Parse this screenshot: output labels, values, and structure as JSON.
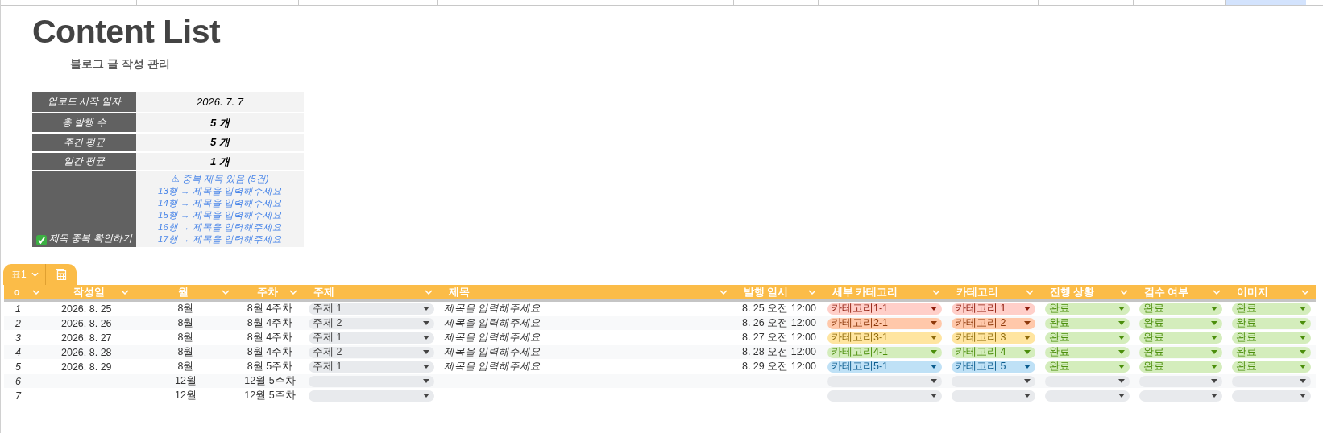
{
  "title": "Content List",
  "subtitle": "블로그 글 작성 관리",
  "summary": [
    {
      "label": "업로드 시작 일자",
      "value": "2026. 7. 7",
      "bold": false
    },
    {
      "label": "총 발행 수",
      "value": "5 개",
      "bold": true
    },
    {
      "label": "주간 평균",
      "value": "5 개",
      "bold": true
    },
    {
      "label": "일간 평균",
      "value": "1 개",
      "bold": true
    }
  ],
  "duplicate_check": {
    "label": "제목 중복 확인하기",
    "lines": [
      "⚠ 중복 제목 있음 (5건)",
      "13행 → 제목을 입력해주세요",
      "14행 → 제목을 입력해주세요",
      "15행 → 제목을 입력해주세요",
      "16행 → 제목을 입력해주세요",
      "17행 → 제목을 입력해주세요"
    ]
  },
  "table_tab": {
    "label": "표1"
  },
  "columns": [
    "o",
    "작성일",
    "월",
    "주차",
    "주제",
    "제목",
    "발행 일시",
    "세부 카테고리",
    "카테고리",
    "진행 상황",
    "검수 여부",
    "이미지"
  ],
  "rows": [
    {
      "no": "1",
      "date": "2026. 8. 25",
      "month": "8월",
      "week": "8월 4주차",
      "topic": {
        "text": "주제 1"
      },
      "title": "제목을 입력해주세요",
      "published": "8. 25 오전 12:00",
      "subcategory": {
        "text": "카테고리1-1",
        "color": "#ffcfc9"
      },
      "category": {
        "text": "카테고리 1",
        "color": "#ffcfc9"
      },
      "status": {
        "text": "완료",
        "color": "#d4edbc"
      },
      "review": {
        "text": "완료",
        "color": "#d4edbc"
      },
      "image": {
        "text": "완료",
        "color": "#d4edbc"
      }
    },
    {
      "no": "2",
      "date": "2026. 8. 26",
      "month": "8월",
      "week": "8월 4주차",
      "topic": {
        "text": "주제 2"
      },
      "title": "제목을 입력해주세요",
      "published": "8. 26 오전 12:00",
      "subcategory": {
        "text": "카테고리2-1",
        "color": "#ffc8aa"
      },
      "category": {
        "text": "카테고리 2",
        "color": "#ffc8aa"
      },
      "status": {
        "text": "완료",
        "color": "#d4edbc"
      },
      "review": {
        "text": "완료",
        "color": "#d4edbc"
      },
      "image": {
        "text": "완료",
        "color": "#d4edbc"
      }
    },
    {
      "no": "3",
      "date": "2026. 8. 27",
      "month": "8월",
      "week": "8월 4주차",
      "topic": {
        "text": "주제 1"
      },
      "title": "제목을 입력해주세요",
      "published": "8. 27 오전 12:00",
      "subcategory": {
        "text": "카테고리3-1",
        "color": "#ffe5a0"
      },
      "category": {
        "text": "카테고리 3",
        "color": "#ffe5a0"
      },
      "status": {
        "text": "완료",
        "color": "#d4edbc"
      },
      "review": {
        "text": "완료",
        "color": "#d4edbc"
      },
      "image": {
        "text": "완료",
        "color": "#d4edbc"
      }
    },
    {
      "no": "4",
      "date": "2026. 8. 28",
      "month": "8월",
      "week": "8월 4주차",
      "topic": {
        "text": "주제 2"
      },
      "title": "제목을 입력해주세요",
      "published": "8. 28 오전 12:00",
      "subcategory": {
        "text": "카테고리4-1",
        "color": "#d4edbc"
      },
      "category": {
        "text": "카테고리 4",
        "color": "#d4edbc"
      },
      "status": {
        "text": "완료",
        "color": "#d4edbc"
      },
      "review": {
        "text": "완료",
        "color": "#d4edbc"
      },
      "image": {
        "text": "완료",
        "color": "#d4edbc"
      }
    },
    {
      "no": "5",
      "date": "2026. 8. 29",
      "month": "8월",
      "week": "8월 5주차",
      "topic": {
        "text": "주제 1"
      },
      "title": "제목을 입력해주세요",
      "published": "8. 29 오전 12:00",
      "subcategory": {
        "text": "카테고리5-1",
        "color": "#bfe1f6"
      },
      "category": {
        "text": "카테고리 5",
        "color": "#bfe1f6"
      },
      "status": {
        "text": "완료",
        "color": "#d4edbc"
      },
      "review": {
        "text": "완료",
        "color": "#d4edbc"
      },
      "image": {
        "text": "완료",
        "color": "#d4edbc"
      }
    },
    {
      "no": "6",
      "month": "12월",
      "week": "12월 5주차",
      "topic": {},
      "subcategory": {},
      "category": {},
      "status": {},
      "review": {},
      "image": {}
    },
    {
      "no": "7",
      "month": "12월",
      "week": "12월 5주차",
      "topic": {},
      "subcategory": {},
      "category": {},
      "status": {},
      "review": {},
      "image": {}
    }
  ]
}
